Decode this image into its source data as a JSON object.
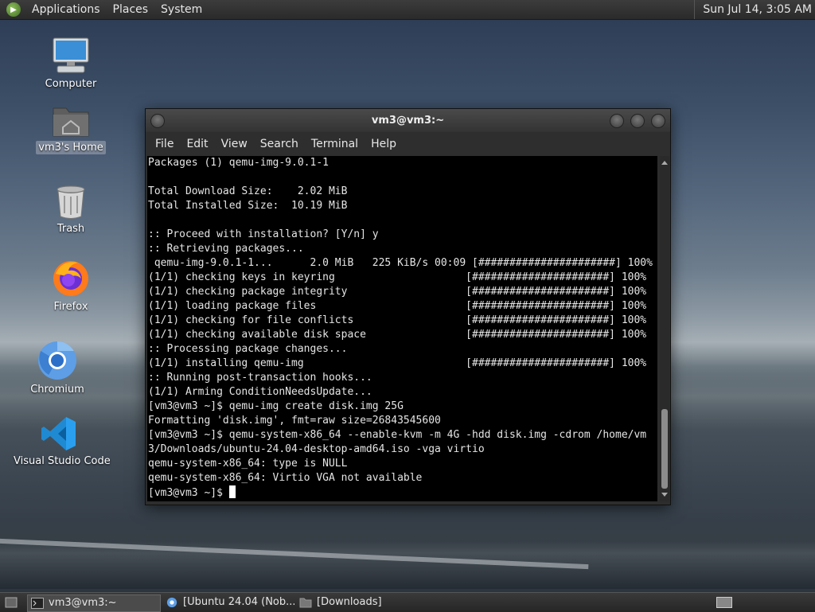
{
  "top_panel": {
    "menus": [
      "Applications",
      "Places",
      "System"
    ],
    "clock": "Sun Jul 14,  3:05 AM"
  },
  "desktop_icons": [
    {
      "label": "Computer",
      "icon": "computer-icon"
    },
    {
      "label": "vm3's Home",
      "icon": "home-folder-icon",
      "selected": true
    },
    {
      "label": "Trash",
      "icon": "trash-icon"
    },
    {
      "label": "Firefox",
      "icon": "firefox-icon"
    },
    {
      "label": "Chromium",
      "icon": "chromium-icon"
    },
    {
      "label": "Visual Studio Code",
      "icon": "vscode-icon"
    }
  ],
  "terminal": {
    "title": "vm3@vm3:~",
    "menu": [
      "File",
      "Edit",
      "View",
      "Search",
      "Terminal",
      "Help"
    ],
    "lines": [
      "Packages (1) qemu-img-9.0.1-1",
      "",
      "Total Download Size:    2.02 MiB",
      "Total Installed Size:  10.19 MiB",
      "",
      ":: Proceed with installation? [Y/n] y",
      ":: Retrieving packages...",
      " qemu-img-9.0.1-1...      2.0 MiB   225 KiB/s 00:09 [######################] 100%",
      "(1/1) checking keys in keyring                     [######################] 100%",
      "(1/1) checking package integrity                   [######################] 100%",
      "(1/1) loading package files                        [######################] 100%",
      "(1/1) checking for file conflicts                  [######################] 100%",
      "(1/1) checking available disk space                [######################] 100%",
      ":: Processing package changes...",
      "(1/1) installing qemu-img                          [######################] 100%",
      ":: Running post-transaction hooks...",
      "(1/1) Arming ConditionNeedsUpdate...",
      "[vm3@vm3 ~]$ qemu-img create disk.img 25G",
      "Formatting 'disk.img', fmt=raw size=26843545600",
      "[vm3@vm3 ~]$ qemu-system-x86_64 --enable-kvm -m 4G -hdd disk.img -cdrom /home/vm",
      "3/Downloads/ubuntu-24.04-desktop-amd64.iso -vga virtio",
      "qemu-system-x86_64: type is NULL",
      "qemu-system-x86_64: Virtio VGA not available"
    ],
    "prompt": "[vm3@vm3 ~]$ "
  },
  "taskbar": {
    "tasks": [
      {
        "label": "vm3@vm3:~",
        "icon": "terminal-icon",
        "active": true
      },
      {
        "label": "[Ubuntu 24.04 (Nob...",
        "icon": "chromium-icon",
        "active": false
      },
      {
        "label": "[Downloads]",
        "icon": "folder-icon",
        "active": false
      }
    ]
  }
}
